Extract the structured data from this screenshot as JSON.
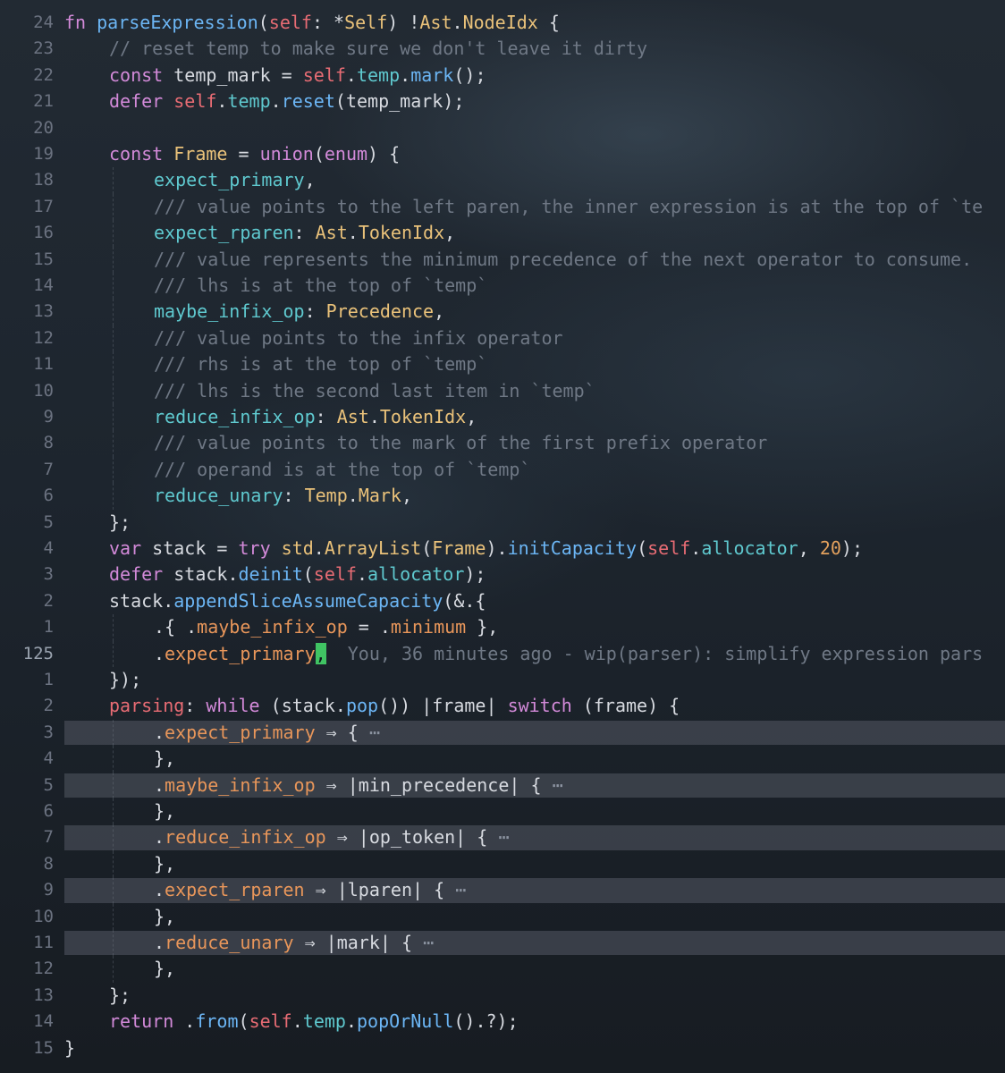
{
  "editor": {
    "lines": [
      {
        "n": "24",
        "indent": 0,
        "tokens": [
          [
            "kw",
            "fn "
          ],
          [
            "fn",
            "parseExpression"
          ],
          [
            "pl",
            "("
          ],
          [
            "self",
            "self"
          ],
          [
            "pl",
            ": *"
          ],
          [
            "ty",
            "Self"
          ],
          [
            "pl",
            ") !"
          ],
          [
            "ty",
            "Ast"
          ],
          [
            "pl",
            "."
          ],
          [
            "ty",
            "NodeIdx"
          ],
          [
            "pl",
            " {"
          ]
        ]
      },
      {
        "n": "23",
        "indent": 1,
        "tokens": [
          [
            "com",
            "// reset temp to make sure we don't leave it dirty"
          ]
        ]
      },
      {
        "n": "22",
        "indent": 1,
        "tokens": [
          [
            "kw",
            "const "
          ],
          [
            "pl",
            "temp_mark = "
          ],
          [
            "self",
            "self"
          ],
          [
            "pl",
            "."
          ],
          [
            "fld",
            "temp"
          ],
          [
            "pl",
            "."
          ],
          [
            "fn",
            "mark"
          ],
          [
            "pl",
            "();"
          ]
        ]
      },
      {
        "n": "21",
        "indent": 1,
        "tokens": [
          [
            "kw",
            "defer "
          ],
          [
            "self",
            "self"
          ],
          [
            "pl",
            "."
          ],
          [
            "fld",
            "temp"
          ],
          [
            "pl",
            "."
          ],
          [
            "fn",
            "reset"
          ],
          [
            "pl",
            "(temp_mark);"
          ]
        ]
      },
      {
        "n": "20",
        "indent": 0,
        "tokens": []
      },
      {
        "n": "19",
        "indent": 1,
        "tokens": [
          [
            "kw",
            "const "
          ],
          [
            "ty",
            "Frame"
          ],
          [
            "pl",
            " = "
          ],
          [
            "kw",
            "union"
          ],
          [
            "pl",
            "("
          ],
          [
            "kw",
            "enum"
          ],
          [
            "pl",
            ") {"
          ]
        ]
      },
      {
        "n": "18",
        "indent": 2,
        "tokens": [
          [
            "fld",
            "expect_primary"
          ],
          [
            "pl",
            ","
          ]
        ]
      },
      {
        "n": "17",
        "indent": 2,
        "tokens": [
          [
            "com",
            "/// value points to the left paren, the inner expression is at the top of `te"
          ]
        ]
      },
      {
        "n": "16",
        "indent": 2,
        "tokens": [
          [
            "fld",
            "expect_rparen"
          ],
          [
            "pl",
            ": "
          ],
          [
            "ty",
            "Ast"
          ],
          [
            "pl",
            "."
          ],
          [
            "ty",
            "TokenIdx"
          ],
          [
            "pl",
            ","
          ]
        ]
      },
      {
        "n": "15",
        "indent": 2,
        "tokens": [
          [
            "com",
            "/// value represents the minimum precedence of the next operator to consume."
          ]
        ]
      },
      {
        "n": "14",
        "indent": 2,
        "tokens": [
          [
            "com",
            "/// lhs is at the top of `temp`"
          ]
        ]
      },
      {
        "n": "13",
        "indent": 2,
        "tokens": [
          [
            "fld",
            "maybe_infix_op"
          ],
          [
            "pl",
            ": "
          ],
          [
            "ty",
            "Precedence"
          ],
          [
            "pl",
            ","
          ]
        ]
      },
      {
        "n": "12",
        "indent": 2,
        "tokens": [
          [
            "com",
            "/// value points to the infix operator"
          ]
        ]
      },
      {
        "n": "11",
        "indent": 2,
        "tokens": [
          [
            "com",
            "/// rhs is at the top of `temp`"
          ]
        ]
      },
      {
        "n": "10",
        "indent": 2,
        "tokens": [
          [
            "com",
            "/// lhs is the second last item in `temp`"
          ]
        ]
      },
      {
        "n": "9",
        "indent": 2,
        "tokens": [
          [
            "fld",
            "reduce_infix_op"
          ],
          [
            "pl",
            ": "
          ],
          [
            "ty",
            "Ast"
          ],
          [
            "pl",
            "."
          ],
          [
            "ty",
            "TokenIdx"
          ],
          [
            "pl",
            ","
          ]
        ]
      },
      {
        "n": "8",
        "indent": 2,
        "tokens": [
          [
            "com",
            "/// value points to the mark of the first prefix operator"
          ]
        ]
      },
      {
        "n": "7",
        "indent": 2,
        "tokens": [
          [
            "com",
            "/// operand is at the top of `temp`"
          ]
        ]
      },
      {
        "n": "6",
        "indent": 2,
        "tokens": [
          [
            "fld",
            "reduce_unary"
          ],
          [
            "pl",
            ": "
          ],
          [
            "ty",
            "Temp"
          ],
          [
            "pl",
            "."
          ],
          [
            "ty",
            "Mark"
          ],
          [
            "pl",
            ","
          ]
        ]
      },
      {
        "n": "5",
        "indent": 1,
        "tokens": [
          [
            "pl",
            "};"
          ]
        ]
      },
      {
        "n": "4",
        "indent": 1,
        "tokens": [
          [
            "kw",
            "var "
          ],
          [
            "pl",
            "stack = "
          ],
          [
            "kw",
            "try "
          ],
          [
            "ty",
            "std"
          ],
          [
            "pl",
            "."
          ],
          [
            "ty",
            "ArrayList"
          ],
          [
            "pl",
            "("
          ],
          [
            "ty",
            "Frame"
          ],
          [
            "pl",
            ")."
          ],
          [
            "fn",
            "initCapacity"
          ],
          [
            "pl",
            "("
          ],
          [
            "self",
            "self"
          ],
          [
            "pl",
            "."
          ],
          [
            "fld",
            "allocator"
          ],
          [
            "pl",
            ", "
          ],
          [
            "num",
            "20"
          ],
          [
            "pl",
            ");"
          ]
        ]
      },
      {
        "n": "3",
        "indent": 1,
        "tokens": [
          [
            "kw",
            "defer "
          ],
          [
            "pl",
            "stack."
          ],
          [
            "fn",
            "deinit"
          ],
          [
            "pl",
            "("
          ],
          [
            "self",
            "self"
          ],
          [
            "pl",
            "."
          ],
          [
            "fld",
            "allocator"
          ],
          [
            "pl",
            ");"
          ]
        ]
      },
      {
        "n": "2",
        "indent": 1,
        "tokens": [
          [
            "pl",
            "stack."
          ],
          [
            "fn",
            "appendSliceAssumeCapacity"
          ],
          [
            "pl",
            "(&.{"
          ]
        ]
      },
      {
        "n": "1",
        "indent": 2,
        "tokens": [
          [
            "pl",
            ".{ ."
          ],
          [
            "enm",
            "maybe_infix_op"
          ],
          [
            "pl",
            " = ."
          ],
          [
            "enm",
            "minimum"
          ],
          [
            "pl",
            " },"
          ]
        ]
      },
      {
        "n": "125",
        "indent": 2,
        "current": true,
        "tokens": [
          [
            "pl",
            "."
          ],
          [
            "enm",
            "expect_primary"
          ],
          [
            "cursor",
            ","
          ],
          [
            "blame",
            "  You, 36 minutes ago - wip(parser): simplify expression pars"
          ]
        ]
      },
      {
        "n": "1",
        "indent": 1,
        "tokens": [
          [
            "pl",
            "});"
          ]
        ]
      },
      {
        "n": "2",
        "indent": 1,
        "tokens": [
          [
            "self",
            "parsing"
          ],
          [
            "pl",
            ": "
          ],
          [
            "kw",
            "while"
          ],
          [
            "pl",
            " (stack."
          ],
          [
            "fn",
            "pop"
          ],
          [
            "pl",
            "()) |frame| "
          ],
          [
            "kw",
            "switch"
          ],
          [
            "pl",
            " (frame) {"
          ]
        ]
      },
      {
        "n": "3",
        "indent": 2,
        "folded": true,
        "tokens": [
          [
            "pl",
            "."
          ],
          [
            "enm",
            "expect_primary"
          ],
          [
            "pl",
            " ⇒ { "
          ],
          [
            "ell",
            "⋯"
          ]
        ]
      },
      {
        "n": "4",
        "indent": 2,
        "tokens": [
          [
            "pl",
            "},"
          ]
        ]
      },
      {
        "n": "5",
        "indent": 2,
        "folded": true,
        "tokens": [
          [
            "pl",
            "."
          ],
          [
            "enm",
            "maybe_infix_op"
          ],
          [
            "pl",
            " ⇒ |min_precedence| { "
          ],
          [
            "ell",
            "⋯"
          ]
        ]
      },
      {
        "n": "6",
        "indent": 2,
        "tokens": [
          [
            "pl",
            "},"
          ]
        ]
      },
      {
        "n": "7",
        "indent": 2,
        "folded": true,
        "tokens": [
          [
            "pl",
            "."
          ],
          [
            "enm",
            "reduce_infix_op"
          ],
          [
            "pl",
            " ⇒ |op_token| { "
          ],
          [
            "ell",
            "⋯"
          ]
        ]
      },
      {
        "n": "8",
        "indent": 2,
        "tokens": [
          [
            "pl",
            "},"
          ]
        ]
      },
      {
        "n": "9",
        "indent": 2,
        "folded": true,
        "tokens": [
          [
            "pl",
            "."
          ],
          [
            "enm",
            "expect_rparen"
          ],
          [
            "pl",
            " ⇒ |lparen| { "
          ],
          [
            "ell",
            "⋯"
          ]
        ]
      },
      {
        "n": "10",
        "indent": 2,
        "tokens": [
          [
            "pl",
            "},"
          ]
        ]
      },
      {
        "n": "11",
        "indent": 2,
        "folded": true,
        "tokens": [
          [
            "pl",
            "."
          ],
          [
            "enm",
            "reduce_unary"
          ],
          [
            "pl",
            " ⇒ |mark| { "
          ],
          [
            "ell",
            "⋯"
          ]
        ]
      },
      {
        "n": "12",
        "indent": 2,
        "tokens": [
          [
            "pl",
            "},"
          ]
        ]
      },
      {
        "n": "13",
        "indent": 1,
        "tokens": [
          [
            "pl",
            "};"
          ]
        ]
      },
      {
        "n": "14",
        "indent": 1,
        "tokens": [
          [
            "kw",
            "return "
          ],
          [
            "pl",
            "."
          ],
          [
            "fn",
            "from"
          ],
          [
            "pl",
            "("
          ],
          [
            "self",
            "self"
          ],
          [
            "pl",
            "."
          ],
          [
            "fld",
            "temp"
          ],
          [
            "pl",
            "."
          ],
          [
            "fn",
            "popOrNull"
          ],
          [
            "pl",
            "().?);"
          ]
        ]
      },
      {
        "n": "15",
        "indent": 0,
        "tokens": [
          [
            "pl",
            "}"
          ]
        ]
      }
    ]
  }
}
